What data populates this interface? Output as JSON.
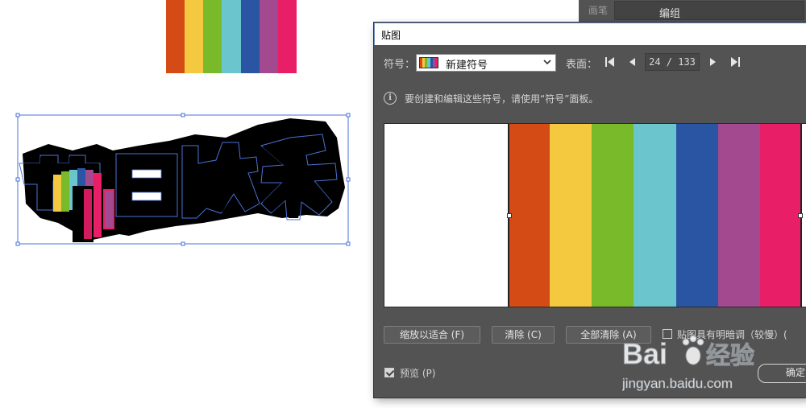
{
  "colors": {
    "stripes": [
      "#d44b16",
      "#f4c83f",
      "#79ba2b",
      "#6bc5cc",
      "#2a55a3",
      "#a2498f",
      "#e81e66"
    ],
    "dialog_bg": "#535353",
    "selection": "#4a72d6"
  },
  "background_panel": {
    "label": "画笔",
    "field_value": "编组"
  },
  "artwork": {
    "text": "节日快乐"
  },
  "dialog": {
    "title": "贴图",
    "symbol_label": "符号：",
    "symbol_value": "新建符号",
    "surface_label": "表面：",
    "page_indicator": "24 / 133",
    "info_text": "要创建和编辑这些符号，请使用“符号”面板。",
    "icons": {
      "info": "info-icon",
      "first": "first-page-icon",
      "prev": "prev-page-icon",
      "next": "next-page-icon",
      "last": "last-page-icon",
      "dropdown": "chevron-down-icon"
    },
    "buttons": {
      "fit": "缩放以适合 (F)",
      "clear": "清除 (C)",
      "clear_all": "全部清除 (A)",
      "ok": "确定"
    },
    "shade_label": "贴图具有明暗调（较慢）(",
    "preview_label": "预览 (P)",
    "preview_checked": true,
    "shade_checked": false
  },
  "watermark": {
    "brand_a": "Bai",
    "brand_b": "经验",
    "url": "jingyan.baidu.com"
  }
}
